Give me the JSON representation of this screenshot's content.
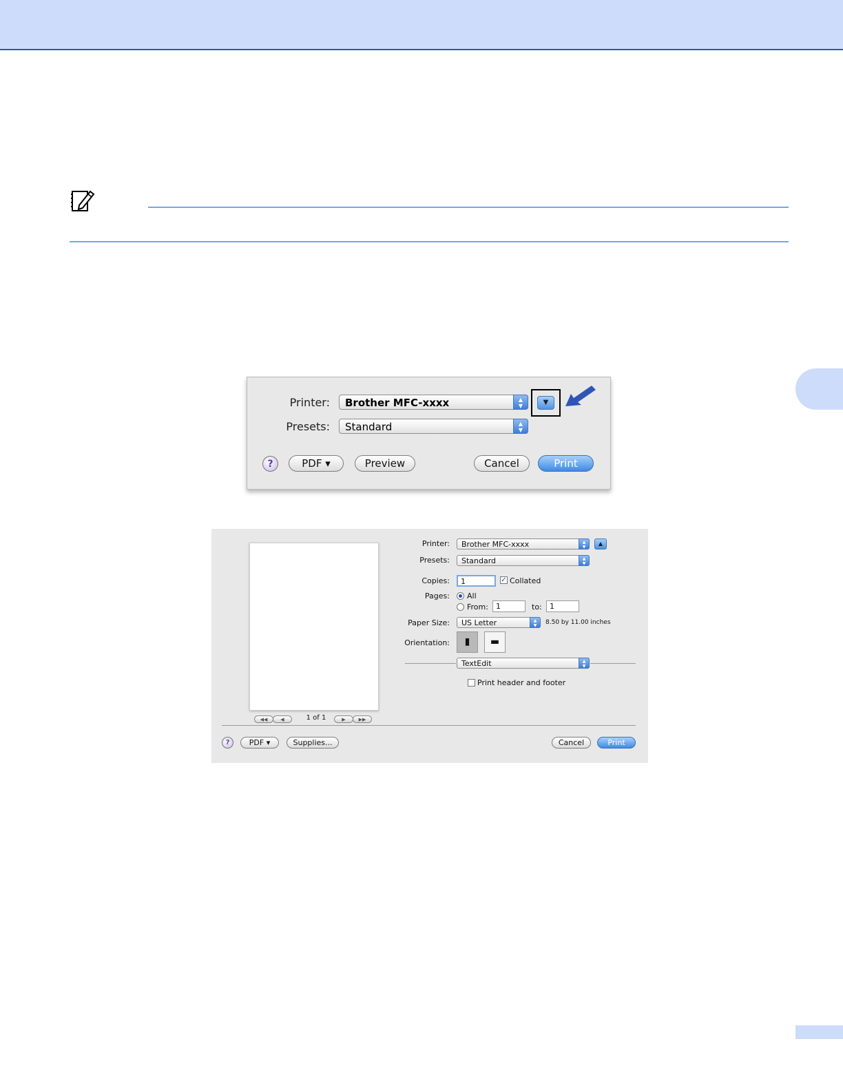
{
  "dialog_basic": {
    "printer_label": "Printer:",
    "printer_value": "Brother MFC-xxxx",
    "presets_label": "Presets:",
    "presets_value": "Standard",
    "help_label": "?",
    "pdf_label": "PDF ▾",
    "preview_label": "Preview",
    "cancel_label": "Cancel",
    "print_label": "Print",
    "disclosure_glyph": "▼"
  },
  "dialog_expanded": {
    "printer_label": "Printer:",
    "printer_value": "Brother MFC-xxxx",
    "presets_label": "Presets:",
    "presets_value": "Standard",
    "copies_label": "Copies:",
    "copies_value": "1",
    "collated_label": "Collated",
    "collated_checked": true,
    "pages_label": "Pages:",
    "pages_all_label": "All",
    "pages_from_label": "From:",
    "pages_from_value": "1",
    "pages_to_label": "to:",
    "pages_to_value": "1",
    "paper_size_label": "Paper Size:",
    "paper_size_value": "US Letter",
    "paper_size_dims": "8.50 by 11.00 inches",
    "orientation_label": "Orientation:",
    "section_value": "TextEdit",
    "header_footer_label": "Print header and footer",
    "page_counter": "1 of 1",
    "nav_first": "◀◀",
    "nav_prev": "◀",
    "nav_next": "▶",
    "nav_last": "▶▶",
    "help_label": "?",
    "pdf_label": "PDF ▾",
    "supplies_label": "Supplies...",
    "cancel_label": "Cancel",
    "print_label": "Print",
    "disclosure_glyph": "▲"
  },
  "colors": {
    "header_band": "#cddcfb",
    "header_rule": "#2a57b8",
    "note_rule": "#7fa0e8",
    "arrow": "#2f55b5",
    "accent_button": "#3f8ae5"
  },
  "icons": [
    "note-icon",
    "arrow-pointer-icon",
    "disclosure-triangle-icon",
    "help-icon",
    "portrait-icon",
    "landscape-icon"
  ]
}
